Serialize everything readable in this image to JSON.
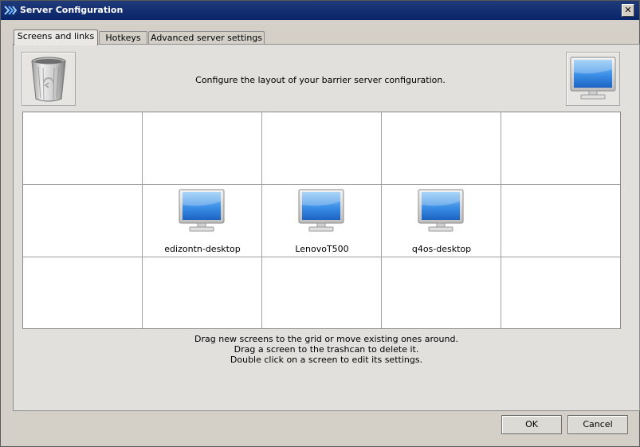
{
  "window": {
    "title": "Server Configuration",
    "close_glyph": "✕"
  },
  "tabs": [
    {
      "label": "Screens and links",
      "active": true
    },
    {
      "label": "Hotkeys",
      "active": false
    },
    {
      "label": "Advanced server settings",
      "active": false
    }
  ],
  "main": {
    "description": "Configure the layout of your barrier server configuration.",
    "trash_icon": "trashcan-icon",
    "new_screen_icon": "monitor-icon",
    "grid": {
      "rows": 3,
      "columns": 5,
      "screens": [
        {
          "name": "edizontn-desktop",
          "row": 2,
          "column": 2
        },
        {
          "name": "LenovoT500",
          "row": 2,
          "column": 3
        },
        {
          "name": "q4os-desktop",
          "row": 2,
          "column": 4
        }
      ]
    },
    "help_lines": [
      "Drag new screens to the grid or move existing ones around.",
      "Drag a screen to the trashcan to delete it.",
      "Double click on a screen to edit its settings."
    ]
  },
  "buttons": {
    "ok": "OK",
    "cancel": "Cancel"
  },
  "colors": {
    "titlebar": "#0a246a",
    "face": "#d4d0c8",
    "monitor_screen": "#3a8ee6"
  }
}
